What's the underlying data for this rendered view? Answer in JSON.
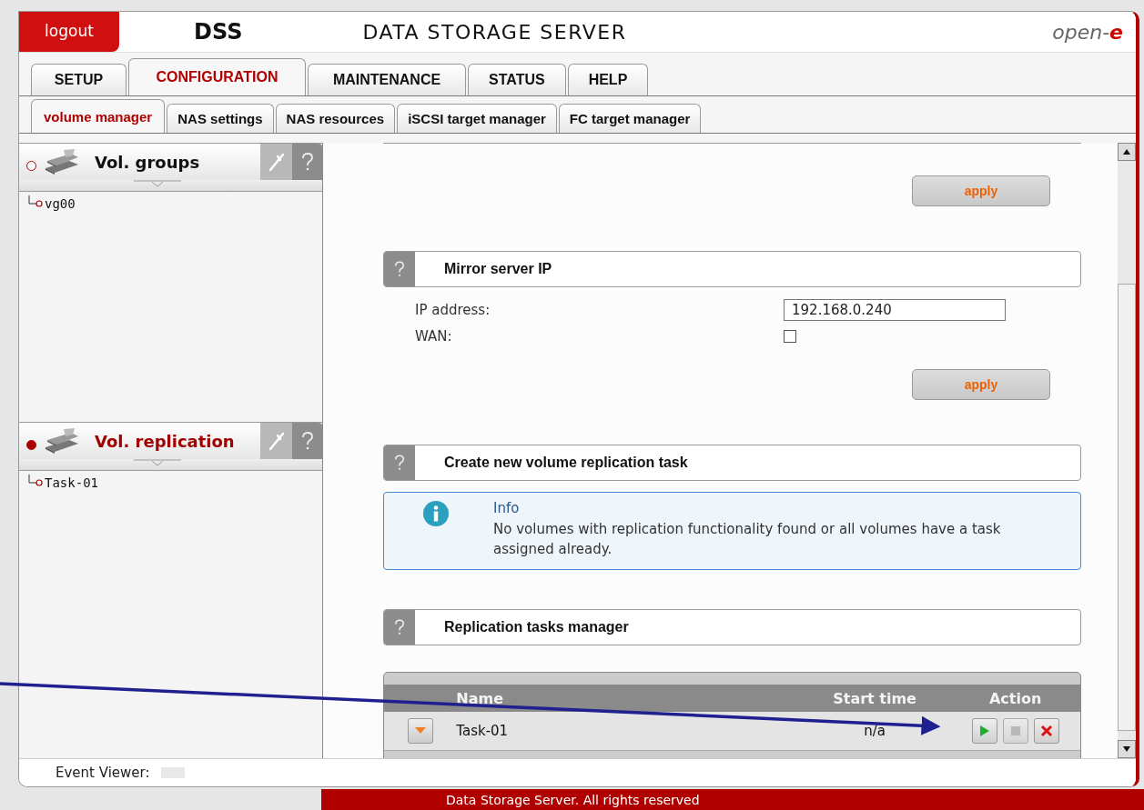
{
  "header": {
    "logout": "logout",
    "product": "DSS",
    "title": "DATA STORAGE SERVER",
    "brand": "open-e"
  },
  "tabs": [
    {
      "label": "SETUP",
      "selected": false
    },
    {
      "label": "CONFIGURATION",
      "selected": true
    },
    {
      "label": "MAINTENANCE",
      "selected": false
    },
    {
      "label": "STATUS",
      "selected": false
    },
    {
      "label": "HELP",
      "selected": false
    }
  ],
  "subtabs": [
    {
      "label": "volume manager",
      "selected": true
    },
    {
      "label": "NAS settings",
      "selected": false
    },
    {
      "label": "NAS resources",
      "selected": false
    },
    {
      "label": "iSCSI target manager",
      "selected": false
    },
    {
      "label": "FC target manager",
      "selected": false
    }
  ],
  "sidebar": {
    "panels": [
      {
        "title": "Vol. groups",
        "selected": false,
        "children": [
          {
            "label": "vg00"
          }
        ]
      },
      {
        "title": "Vol. replication",
        "selected": true,
        "children": [
          {
            "label": "Task-01"
          }
        ]
      }
    ]
  },
  "main": {
    "top_apply": "apply",
    "mirror": {
      "title": "Mirror server IP",
      "ip_label": "IP address:",
      "ip_value": "192.168.0.240",
      "wan_label": "WAN:",
      "wan_checked": false,
      "apply": "apply"
    },
    "create": {
      "title": "Create new volume replication task",
      "info_title": "Info",
      "info_text": "No volumes with replication functionality found or all volumes have a task assigned already."
    },
    "manager": {
      "title": "Replication tasks manager",
      "columns": [
        "Name",
        "Start time",
        "Action"
      ],
      "rows": [
        {
          "name": "Task-01",
          "start_time": "n/a",
          "stop_disabled": true
        }
      ]
    }
  },
  "event_viewer": "Event Viewer:",
  "footer": "Data Storage Server. All rights reserved"
}
